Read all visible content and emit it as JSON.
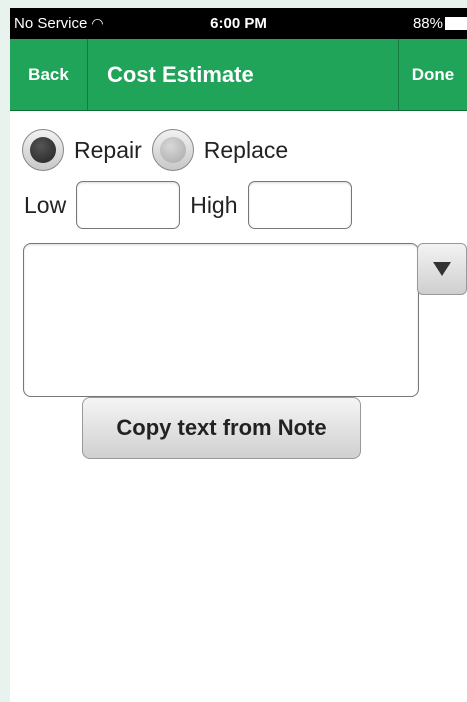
{
  "status_bar": {
    "carrier": "No Service",
    "wifi_icon": "wifi-icon",
    "time": "6:00 PM",
    "battery": "88%",
    "battery_icon": "battery-icon"
  },
  "nav": {
    "back_label": "Back",
    "title": "Cost Estimate",
    "done_label": "Done"
  },
  "form": {
    "repair_label": "Repair",
    "replace_label": "Replace",
    "selected_option": "Repair",
    "low_label": "Low",
    "low_value": "",
    "high_label": "High",
    "high_value": "",
    "note_value": "",
    "dropdown_icon": "triangle-down-icon",
    "copy_button_label": "Copy text from Note"
  },
  "colors": {
    "nav_green": "#1fa45a",
    "status_bar": "#000000"
  }
}
